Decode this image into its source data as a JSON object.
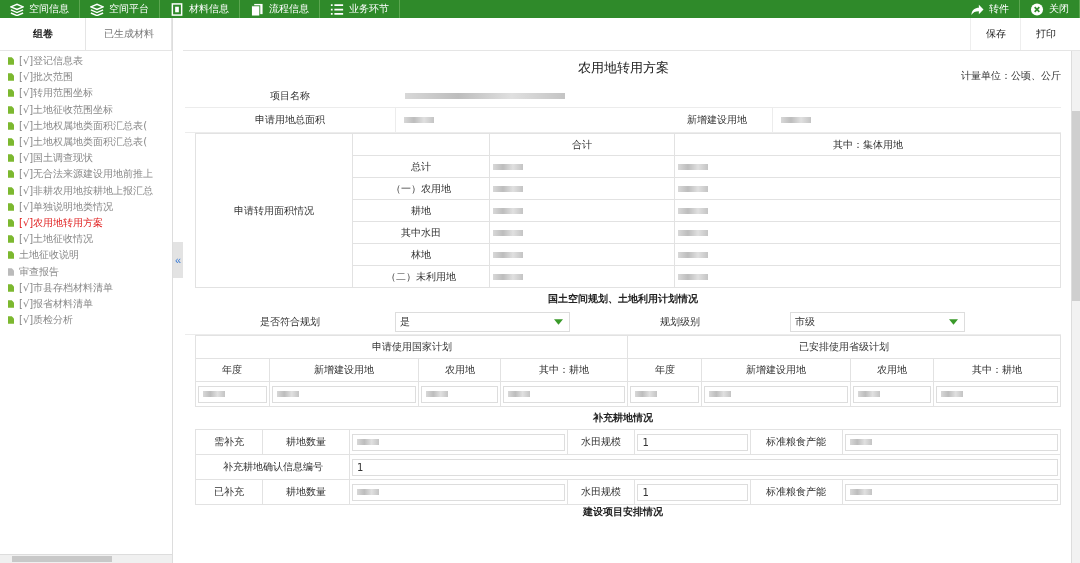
{
  "toolbar": {
    "left": [
      {
        "label": "空间信息",
        "kind": "layers"
      },
      {
        "label": "空间平台",
        "kind": "layers"
      },
      {
        "label": "材料信息",
        "kind": "document"
      },
      {
        "label": "流程信息",
        "kind": "copy"
      },
      {
        "label": "业务环节",
        "kind": "list"
      }
    ],
    "right": [
      {
        "label": "转件",
        "kind": "forward"
      },
      {
        "label": "关闭",
        "kind": "close"
      }
    ]
  },
  "sidebar": {
    "tabs": [
      {
        "label": "组卷",
        "selected": true
      },
      {
        "label": "已生成材料",
        "selected": false
      }
    ],
    "items": [
      {
        "label": "[√]登记信息表",
        "selected": false,
        "enabled": true
      },
      {
        "label": "[√]批次范围",
        "selected": false,
        "enabled": true
      },
      {
        "label": "[√]转用范围坐标",
        "selected": false,
        "enabled": true
      },
      {
        "label": "[√]土地征收范围坐标",
        "selected": false,
        "enabled": true
      },
      {
        "label": "[√]土地权属地类面积汇总表(",
        "selected": false,
        "enabled": true
      },
      {
        "label": "[√]土地权属地类面积汇总表(",
        "selected": false,
        "enabled": true
      },
      {
        "label": "[√]国土调查现状",
        "selected": false,
        "enabled": true
      },
      {
        "label": "[√]无合法来源建设用地前推上",
        "selected": false,
        "enabled": true
      },
      {
        "label": "[√]非耕农用地按耕地上报汇总",
        "selected": false,
        "enabled": true
      },
      {
        "label": "[√]单独说明地类情况",
        "selected": false,
        "enabled": true
      },
      {
        "label": "[√]农用地转用方案",
        "selected": true,
        "enabled": true
      },
      {
        "label": "[√]土地征收情况",
        "selected": false,
        "enabled": true
      },
      {
        "label": "土地征收说明",
        "selected": false,
        "enabled": true
      },
      {
        "label": "审查报告",
        "selected": false,
        "enabled": false
      },
      {
        "label": "[√]市县存档材料清单",
        "selected": false,
        "enabled": true
      },
      {
        "label": "[√]报省材料清单",
        "selected": false,
        "enabled": true
      },
      {
        "label": "[√]质检分析",
        "selected": false,
        "enabled": true
      }
    ],
    "collapse": "«"
  },
  "actions": [
    "保存",
    "打印"
  ],
  "form": {
    "title": "农用地转用方案",
    "unit": "计量单位：公顷、公斤",
    "project_name_label": "项目名称",
    "total_area_label": "申请用地总面积",
    "new_construction_label": "新增建设用地",
    "area_table": {
      "label": "申请转用面积情况",
      "columns": [
        "合计",
        "其中：集体用地"
      ],
      "rows": [
        {
          "label": "总计",
          "cells": [
            {
              "kind": "blur"
            },
            {
              "kind": "blur"
            }
          ]
        },
        {
          "label": "（一）农用地",
          "cells": [
            {
              "kind": "blur"
            },
            {
              "kind": "blur"
            }
          ]
        },
        {
          "label": "耕地",
          "cells": [
            {
              "kind": "blur"
            },
            {
              "kind": "blur"
            }
          ]
        },
        {
          "label": "其中水田",
          "cells": [
            {
              "kind": "blur"
            },
            {
              "kind": "blur"
            }
          ]
        },
        {
          "label": "林地",
          "cells": [
            {
              "kind": "blur"
            },
            {
              "kind": "blur"
            }
          ]
        },
        {
          "label": "（二）未利用地",
          "cells": [
            {
              "kind": "blur"
            },
            {
              "kind": "blur"
            }
          ]
        }
      ]
    },
    "planning": {
      "title": "国土空间规划、土地利用计划情况",
      "selects": [
        {
          "label": "是否符合规划",
          "value": "是"
        },
        {
          "label": "规划级别",
          "value": "市级"
        }
      ],
      "groups": [
        "申请使用国家计划",
        "已安排使用省级计划"
      ],
      "columns": [
        "年度",
        "新增建设用地",
        "农用地",
        "其中：耕地",
        "年度",
        "新增建设用地",
        "农用地",
        "其中：耕地"
      ],
      "inputs": [
        {
          "kind": "blur"
        },
        {
          "kind": "blur"
        },
        {
          "kind": "blur"
        },
        {
          "kind": "blur"
        },
        {
          "kind": "blur"
        },
        {
          "kind": "blur"
        },
        {
          "kind": "blur"
        },
        {
          "kind": "blur"
        }
      ]
    },
    "supplement": {
      "title": "补充耕地情况",
      "need": {
        "label": "需补充",
        "qty_label": "耕地数量",
        "qty": {
          "kind": "blur"
        },
        "paddy_label": "水田规模",
        "paddy": {
          "kind": "text",
          "value": "1"
        },
        "grain_label": "标准粮食产能",
        "grain": {
          "kind": "blur"
        }
      },
      "confirm_label": "补充耕地确认信息编号",
      "confirm": {
        "kind": "text",
        "value": "1"
      },
      "done": {
        "label": "已补充",
        "qty_label": "耕地数量",
        "qty": {
          "kind": "blur"
        },
        "paddy_label": "水田规模",
        "paddy": {
          "kind": "text",
          "value": "1"
        },
        "grain_label": "标准粮食产能",
        "grain": {
          "kind": "blur"
        }
      }
    },
    "next_section_title": "建设项目安排情况"
  }
}
